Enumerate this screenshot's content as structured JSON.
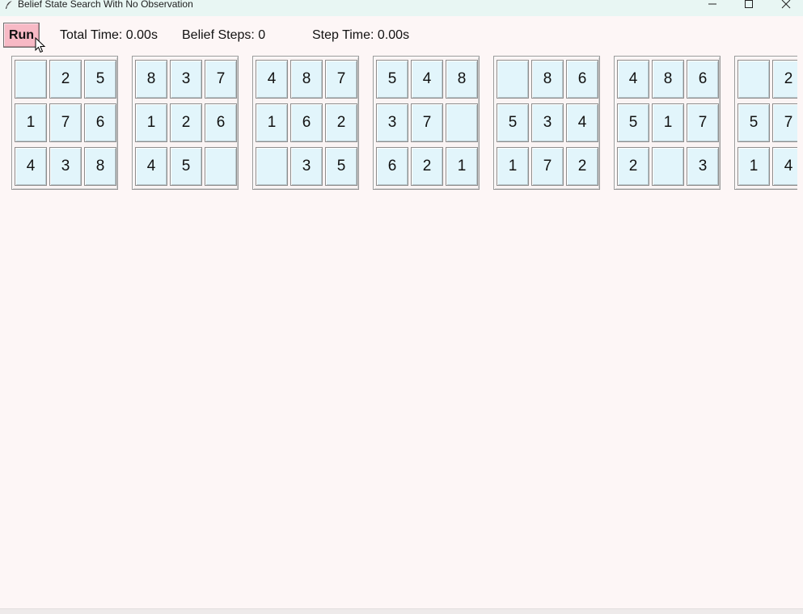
{
  "window": {
    "title": "Belief State Search With No Observation",
    "icon": "feather-icon",
    "controls": [
      "minimize-icon",
      "maximize-icon",
      "close-icon"
    ]
  },
  "toolbar": {
    "run_label": "Run",
    "run_color": "#f7b9c5",
    "total_time": "Total Time: 0.00s",
    "belief_steps": "Belief Steps: 0",
    "step_time": "Step Time: 0.00s"
  },
  "colors": {
    "background": "#fdf6f6",
    "cell_background": "#e2f5fb",
    "titlebar": "#e8f6f3"
  },
  "boards": [
    [
      [
        "",
        "2",
        "5"
      ],
      [
        "1",
        "7",
        "6"
      ],
      [
        "4",
        "3",
        "8"
      ]
    ],
    [
      [
        "8",
        "3",
        "7"
      ],
      [
        "1",
        "2",
        "6"
      ],
      [
        "4",
        "5",
        ""
      ]
    ],
    [
      [
        "4",
        "8",
        "7"
      ],
      [
        "1",
        "6",
        "2"
      ],
      [
        "",
        "3",
        "5"
      ]
    ],
    [
      [
        "5",
        "4",
        "8"
      ],
      [
        "3",
        "7",
        ""
      ],
      [
        "6",
        "2",
        "1"
      ]
    ],
    [
      [
        "",
        "8",
        "6"
      ],
      [
        "5",
        "3",
        "4"
      ],
      [
        "1",
        "7",
        "2"
      ]
    ],
    [
      [
        "4",
        "8",
        "6"
      ],
      [
        "5",
        "1",
        "7"
      ],
      [
        "2",
        "",
        "3"
      ]
    ],
    [
      [
        "",
        "2",
        ""
      ],
      [
        "5",
        "7",
        ""
      ],
      [
        "1",
        "4",
        ""
      ]
    ]
  ]
}
